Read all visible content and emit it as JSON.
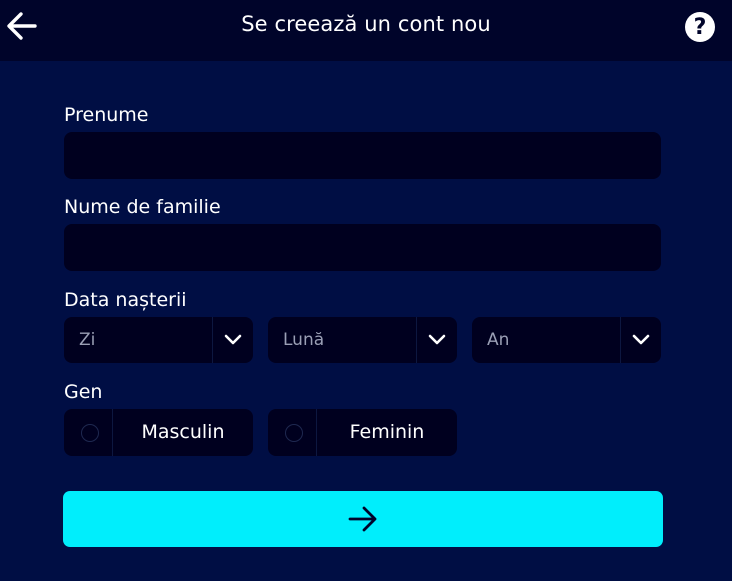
{
  "header": {
    "title": "Se creează un cont nou",
    "back_icon": "arrow-left-icon",
    "help_icon": "question-circle-icon",
    "help_glyph": "?"
  },
  "form": {
    "first_name": {
      "label": "Prenume",
      "value": ""
    },
    "last_name": {
      "label": "Nume de familie",
      "value": ""
    },
    "birth_date": {
      "label": "Data nașterii",
      "day_placeholder": "Zi",
      "month_placeholder": "Lună",
      "year_placeholder": "An"
    },
    "gender": {
      "label": "Gen",
      "options": [
        "Masculin",
        "Feminin"
      ]
    },
    "submit_icon": "arrow-right-icon"
  },
  "colors": {
    "background": "#000e44",
    "header_background": "#00042a",
    "field_background": "#00001f",
    "accent": "#00eefc"
  }
}
